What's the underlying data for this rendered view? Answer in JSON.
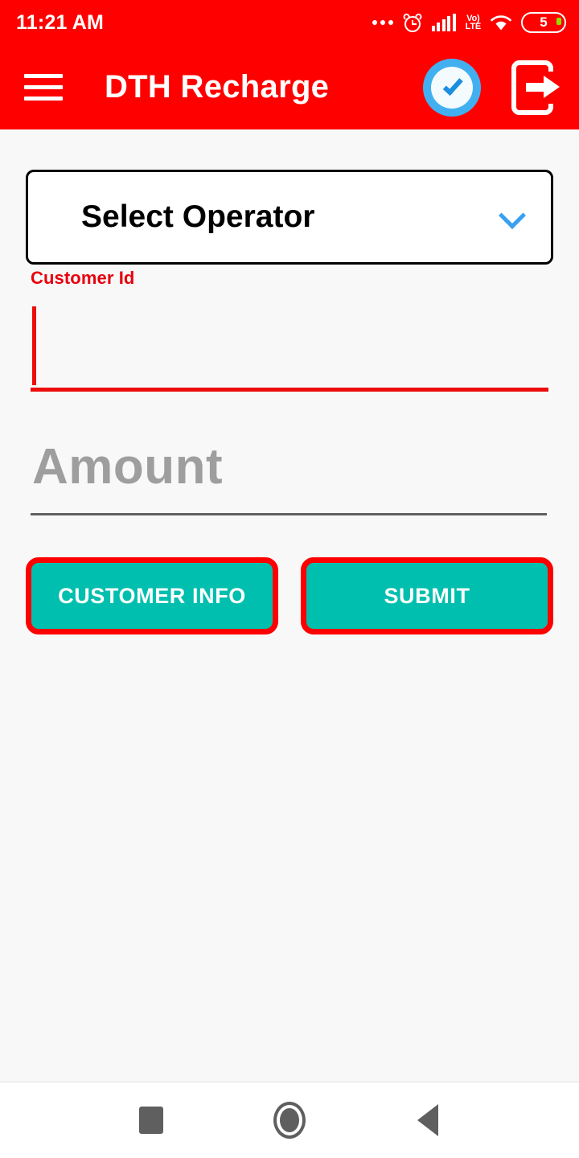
{
  "status_bar": {
    "time": "11:21 AM",
    "icons": {
      "more": "ellipsis-icon",
      "alarm": "alarm-clock-icon",
      "signal": "cellular-signal-icon",
      "network_label_top": "Vo)",
      "network_label_bottom": "LTE",
      "wifi": "wifi-icon",
      "battery": "battery-icon"
    },
    "battery_level": "5"
  },
  "app_bar": {
    "menu_icon": "hamburger-menu-icon",
    "title": "DTH Recharge",
    "verified_icon": "verified-check-icon",
    "logout_icon": "logout-icon",
    "background_color": "#FF0000"
  },
  "form": {
    "operator": {
      "label": "Select Operator",
      "chevron_icon": "chevron-down-icon",
      "chevron_color": "#3AA0F0"
    },
    "customer_id": {
      "label": "Customer Id",
      "value": "",
      "placeholder": "",
      "accent_color": "#EC0C0C",
      "focused": "true"
    },
    "amount": {
      "label": "",
      "value": "",
      "placeholder": "Amount",
      "underline_color": "#606060"
    },
    "buttons": {
      "customer_info": "CUSTOMER INFO",
      "submit": "SUBMIT",
      "fill_color": "#00BFAE",
      "border_color": "#FF0000"
    }
  },
  "nav_bar": {
    "recents": "recents-square-icon",
    "home": "home-circle-icon",
    "back": "back-triangle-icon"
  }
}
